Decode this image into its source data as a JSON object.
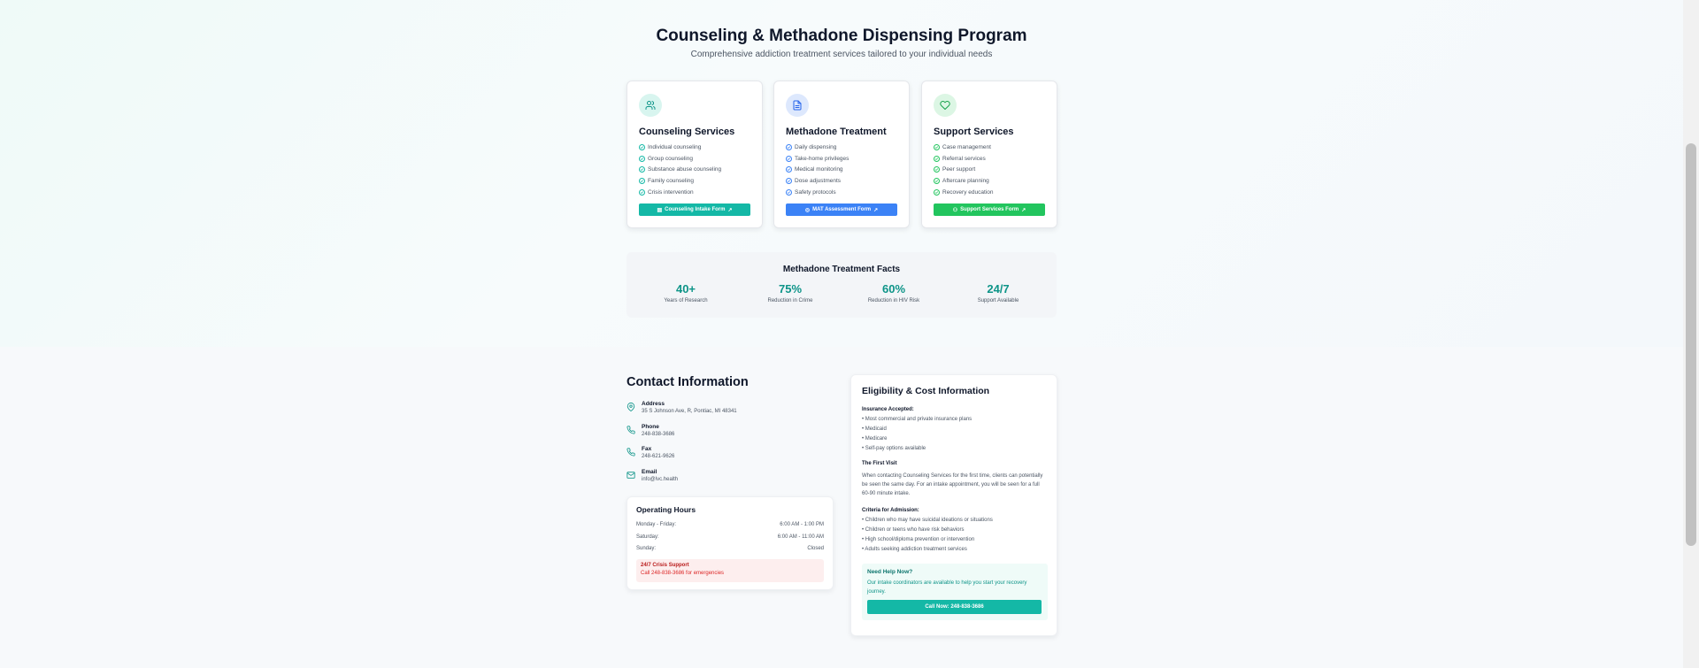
{
  "program": {
    "title": "Counseling & Methadone Dispensing Program",
    "subtitle": "Comprehensive addiction treatment services tailored to your individual needs"
  },
  "cards": [
    {
      "title": "Counseling Services",
      "icon": "users-icon",
      "accent": "#14b8a6",
      "items": [
        "Individual counseling",
        "Group counseling",
        "Substance abuse counseling",
        "Family counseling",
        "Crisis intervention"
      ],
      "button": "Counseling Intake Form"
    },
    {
      "title": "Methadone Treatment",
      "icon": "document-icon",
      "accent": "#3b82f6",
      "items": [
        "Daily dispensing",
        "Take-home privileges",
        "Medical monitoring",
        "Dose adjustments",
        "Safety protocols"
      ],
      "button": "MAT Assessment Form"
    },
    {
      "title": "Support Services",
      "icon": "heart-icon",
      "accent": "#22c55e",
      "items": [
        "Case management",
        "Referral services",
        "Peer support",
        "Aftercare planning",
        "Recovery education"
      ],
      "button": "Support Services Form"
    }
  ],
  "facts": {
    "title": "Methadone Treatment Facts",
    "items": [
      {
        "value": "40+",
        "label": "Years of Research"
      },
      {
        "value": "75%",
        "label": "Reduction in Crime"
      },
      {
        "value": "60%",
        "label": "Reduction in HIV Risk"
      },
      {
        "value": "24/7",
        "label": "Support Available"
      }
    ]
  },
  "contact": {
    "title": "Contact Information",
    "address": {
      "label": "Address",
      "value": "35 S Johnson Ave, R, Pontiac, MI 48341"
    },
    "phone": {
      "label": "Phone",
      "value": "248-838-3686"
    },
    "fax": {
      "label": "Fax",
      "value": "248-621-9626"
    },
    "email": {
      "label": "Email",
      "value": "info@lvc.health"
    }
  },
  "hours": {
    "title": "Operating Hours",
    "rows": [
      {
        "day": "Monday - Friday:",
        "time": "6:00 AM - 1:00 PM"
      },
      {
        "day": "Saturday:",
        "time": "6:00 AM - 11:00 AM"
      },
      {
        "day": "Sunday:",
        "time": "Closed"
      }
    ],
    "crisis_title": "24/7 Crisis Support",
    "crisis_text": "Call 248-838-3686 for emergencies"
  },
  "eligibility": {
    "title": "Eligibility & Cost Information",
    "insurance_heading": "Insurance Accepted:",
    "insurance": [
      "• Most commercial and private insurance plans",
      "• Medicaid",
      "• Medicare",
      "• Self-pay options available"
    ],
    "first_visit_heading": "The First Visit",
    "first_visit_text": "When contacting Counseling Services for the first time, clients can potentially be seen the same day. For an intake appointment, you will be seen for a full 60-90 minute intake.",
    "criteria_heading": "Criteria for Admission:",
    "criteria": [
      "• Children who may have suicidal ideations or situations",
      "• Children or teens who have risk behaviors",
      "• High school/diploma prevention or intervention",
      "• Adults seeking addiction treatment services"
    ],
    "help_title": "Need Help Now?",
    "help_text": "Our intake coordinators are available to help you start your recovery journey.",
    "help_button": "Call Now: 248-838-3686"
  },
  "colors": {
    "teal": "#14b8a6",
    "blue": "#3b82f6",
    "green": "#22c55e",
    "fact_value": "#0d9488",
    "crisis": "#dc2626"
  }
}
